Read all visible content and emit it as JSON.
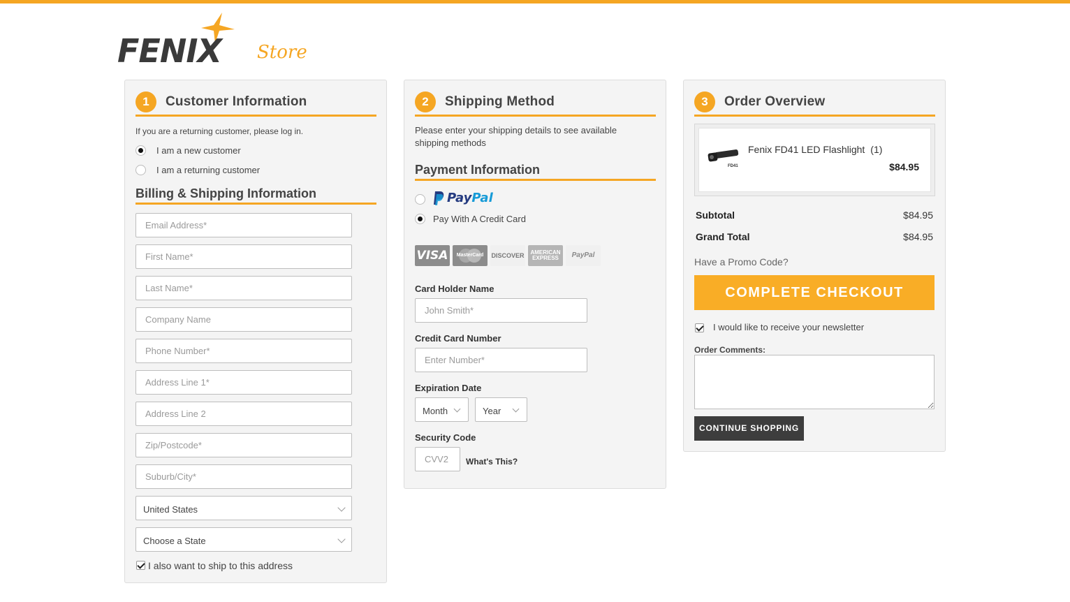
{
  "brand": {
    "name": "FENIX",
    "sub": "Store",
    "accent_color": "#f5a623",
    "text_color": "#3a3a3a"
  },
  "customer": {
    "step": "1",
    "title": "Customer Information",
    "returning_note": "If you are a returning customer, please log in.",
    "radio_new": "I am a new customer",
    "radio_returning": "I am a returning customer",
    "billing_title": "Billing & Shipping Information",
    "fields": {
      "email": "Email Address*",
      "first_name": "First Name*",
      "last_name": "Last Name*",
      "company": "Company Name",
      "phone": "Phone Number*",
      "address1": "Address Line 1*",
      "address2": "Address Line 2",
      "zip": "Zip/Postcode*",
      "city": "Suburb/City*"
    },
    "country": "United States",
    "state": "Choose a State",
    "ship_same": "I also want to ship to this address"
  },
  "shipping": {
    "step": "2",
    "title": "Shipping Method",
    "note": "Please enter your shipping details to see available shipping methods",
    "payment_title": "Payment Information",
    "paypal_pay": "Pay",
    "paypal_pal": "Pal",
    "pay_credit": "Pay With A Credit Card",
    "cards": {
      "visa": "VISA",
      "mastercard": "MasterCard",
      "discover": "DISCOVER",
      "amex": "AMERICAN EXPRESS",
      "paypal": "PayPal"
    },
    "card_holder_label": "Card Holder Name",
    "card_holder_placeholder": "John Smith*",
    "card_number_label": "Credit Card Number",
    "card_number_placeholder": "Enter Number*",
    "expiry_label": "Expiration Date",
    "month": "Month",
    "year": "Year",
    "security_label": "Security Code",
    "cvv_placeholder": "CVV2",
    "whats_this": "What's This?"
  },
  "overview": {
    "step": "3",
    "title": "Order Overview",
    "product_name": "Fenix FD41 LED Flashlight",
    "product_qty": "(1)",
    "product_img_label": "FD41",
    "product_price": "$84.95",
    "subtotal_label": "Subtotal",
    "subtotal": "$84.95",
    "grand_total_label": "Grand Total",
    "grand_total": "$84.95",
    "promo": "Have a Promo Code?",
    "checkout": "COMPLETE CHECKOUT",
    "newsletter": "I would like to receive your newsletter",
    "comments_label": "Order Comments:",
    "continue": "CONTINUE SHOPPING"
  }
}
